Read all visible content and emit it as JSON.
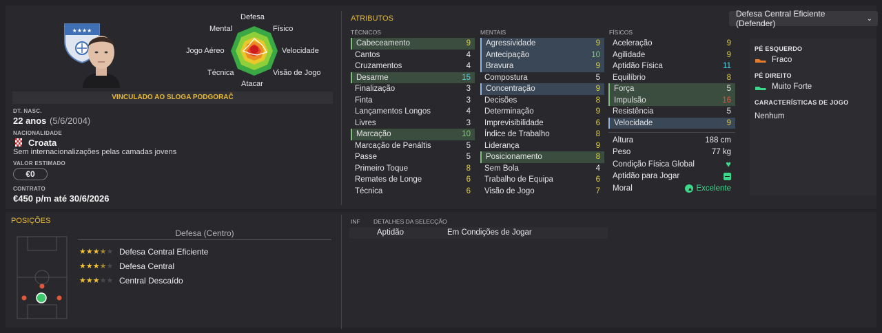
{
  "player": {
    "contract_club": "VINCULADO AO SLOGA PODGORAČ",
    "dob_label": "DT. NASC.",
    "age": "22 anos",
    "dob": "(5/6/2004)",
    "nationality_label": "NACIONALIDADE",
    "nationality": "Croata",
    "caps_note": "Sem internacionalizações pelas camadas jovens",
    "value_label": "VALOR ESTIMADO",
    "value": "€0",
    "contract_label": "CONTRATO",
    "contract": "€450 p/m até 30/6/2026"
  },
  "radar": {
    "labels": {
      "top": "Defesa",
      "top_left": "Mental",
      "top_right": "Físico",
      "left": "Jogo Aéreo",
      "right": "Velocidade",
      "bottom_left": "Técnica",
      "bottom_right": "Visão de Jogo",
      "bottom": "Atacar"
    }
  },
  "attributes": {
    "title": "ATRIBUTOS",
    "tecnicos_label": "TÉCNICOS",
    "mentais_label": "MENTAIS",
    "fisicos_label": "FÍSICOS",
    "tecnicos": [
      {
        "name": "Cabeceamento",
        "value": "9",
        "hl": "green",
        "color": "y"
      },
      {
        "name": "Cantos",
        "value": "4",
        "hl": "",
        "color": "w"
      },
      {
        "name": "Cruzamentos",
        "value": "4",
        "hl": "",
        "color": "w"
      },
      {
        "name": "Desarme",
        "value": "15",
        "hl": "green",
        "color": "c"
      },
      {
        "name": "Finalização",
        "value": "3",
        "hl": "",
        "color": "w"
      },
      {
        "name": "Finta",
        "value": "3",
        "hl": "",
        "color": "w"
      },
      {
        "name": "Lançamentos Longos",
        "value": "4",
        "hl": "",
        "color": "w"
      },
      {
        "name": "Livres",
        "value": "3",
        "hl": "",
        "color": "w"
      },
      {
        "name": "Marcação",
        "value": "10",
        "hl": "green",
        "color": "g"
      },
      {
        "name": "Marcação de Penáltis",
        "value": "5",
        "hl": "",
        "color": "w"
      },
      {
        "name": "Passe",
        "value": "5",
        "hl": "",
        "color": "w"
      },
      {
        "name": "Primeiro Toque",
        "value": "8",
        "hl": "",
        "color": "y"
      },
      {
        "name": "Remates de Longe",
        "value": "6",
        "hl": "",
        "color": "y"
      },
      {
        "name": "Técnica",
        "value": "6",
        "hl": "",
        "color": "y"
      }
    ],
    "mentais": [
      {
        "name": "Agressividade",
        "value": "9",
        "hl": "blue",
        "color": "y"
      },
      {
        "name": "Antecipação",
        "value": "10",
        "hl": "blue",
        "color": "g"
      },
      {
        "name": "Bravura",
        "value": "9",
        "hl": "blue",
        "color": "y"
      },
      {
        "name": "Compostura",
        "value": "5",
        "hl": "",
        "color": "w"
      },
      {
        "name": "Concentração",
        "value": "9",
        "hl": "blue",
        "color": "y"
      },
      {
        "name": "Decisões",
        "value": "8",
        "hl": "",
        "color": "y"
      },
      {
        "name": "Determinação",
        "value": "9",
        "hl": "",
        "color": "y"
      },
      {
        "name": "Imprevisibilidade",
        "value": "6",
        "hl": "",
        "color": "y"
      },
      {
        "name": "Índice de Trabalho",
        "value": "8",
        "hl": "",
        "color": "y"
      },
      {
        "name": "Liderança",
        "value": "9",
        "hl": "",
        "color": "y"
      },
      {
        "name": "Posicionamento",
        "value": "8",
        "hl": "green",
        "color": "y"
      },
      {
        "name": "Sem Bola",
        "value": "4",
        "hl": "",
        "color": "w"
      },
      {
        "name": "Trabalho de Equipa",
        "value": "6",
        "hl": "",
        "color": "y"
      },
      {
        "name": "Visão de Jogo",
        "value": "7",
        "hl": "",
        "color": "y"
      }
    ],
    "fisicos": [
      {
        "name": "Aceleração",
        "value": "9",
        "hl": "",
        "color": "y"
      },
      {
        "name": "Agilidade",
        "value": "9",
        "hl": "",
        "color": "y"
      },
      {
        "name": "Aptidão Física",
        "value": "11",
        "hl": "",
        "color": "c"
      },
      {
        "name": "Equilíbrio",
        "value": "8",
        "hl": "",
        "color": "y"
      },
      {
        "name": "Força",
        "value": "5",
        "hl": "green",
        "color": "w"
      },
      {
        "name": "Impulsão",
        "value": "16",
        "hl": "green",
        "color": "r"
      },
      {
        "name": "Resistência",
        "value": "5",
        "hl": "",
        "color": "w"
      },
      {
        "name": "Velocidade",
        "value": "9",
        "hl": "blue",
        "color": "y"
      }
    ],
    "physical_info": [
      {
        "name": "Altura",
        "value": "188 cm"
      },
      {
        "name": "Peso",
        "value": "77 kg"
      },
      {
        "name": "Condição Física Global",
        "value": ""
      },
      {
        "name": "Aptidão para Jogar",
        "value": ""
      },
      {
        "name": "Moral",
        "value": "Excelente"
      }
    ]
  },
  "role_dropdown": "Defesa Central Eficiente (Defender)",
  "sidebar": {
    "left_foot_label": "PÉ ESQUERDO",
    "left_foot": "Fraco",
    "right_foot_label": "PÉ DIREITO",
    "right_foot": "Muito Forte",
    "traits_label": "CARACTERÍSTICAS DE JOGO",
    "traits": "Nenhum"
  },
  "positions": {
    "title": "POSIÇÕES",
    "group": "Defesa (Centro)",
    "roles": [
      {
        "name": "Defesa Central Eficiente",
        "stars": 3.5
      },
      {
        "name": "Defesa Central",
        "stars": 3.5
      },
      {
        "name": "Central Descaído",
        "stars": 3
      }
    ]
  },
  "selection": {
    "inf_label": "INF",
    "details_label": "DETALHES DA SELECÇÃO",
    "row_label": "Aptidão",
    "row_value": "Em Condições de Jogar"
  },
  "colors": {
    "accent_gold": "#e8b935",
    "highlight_green": "#3b4d3e",
    "highlight_blue": "#3a4757"
  }
}
